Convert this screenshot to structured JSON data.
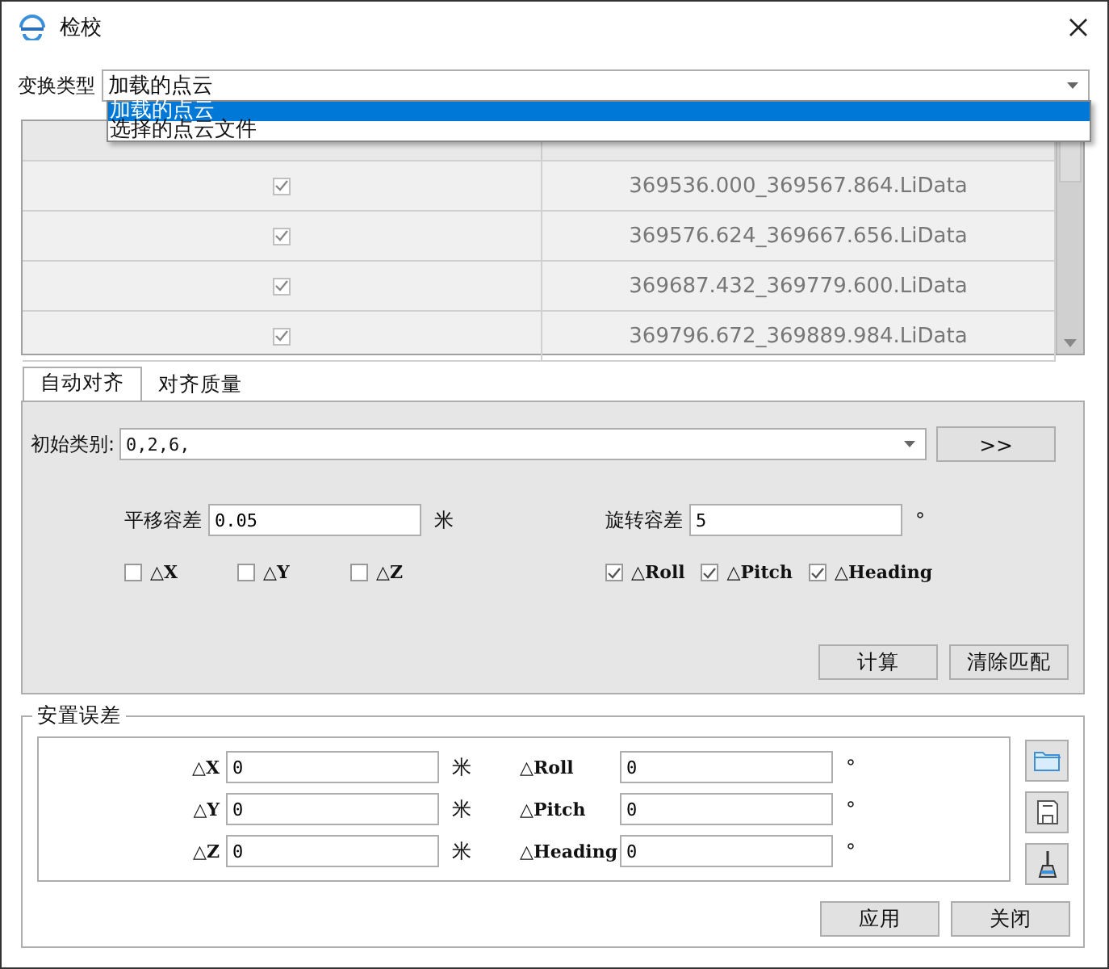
{
  "window": {
    "title": "检校"
  },
  "transform": {
    "label": "变换类型",
    "value": "加载的点云",
    "options": [
      {
        "label": "加载的点云",
        "selected": true
      },
      {
        "label": "选择的点云文件",
        "selected": false
      }
    ]
  },
  "table": {
    "rows": [
      {
        "checked": true,
        "file": "369536.000_369567.864.LiData"
      },
      {
        "checked": true,
        "file": "369576.624_369667.656.LiData"
      },
      {
        "checked": true,
        "file": "369687.432_369779.600.LiData"
      },
      {
        "checked": true,
        "file": "369796.672_369889.984.LiData"
      }
    ]
  },
  "tabs": [
    {
      "label": "自动对齐",
      "selected": true
    },
    {
      "label": "对齐质量",
      "selected": false
    }
  ],
  "auto_align": {
    "initial_class": {
      "label": "初始类别:",
      "value": "0,2,6,"
    },
    "more_button": ">>",
    "translation_tolerance": {
      "label": "平移容差",
      "value": "0.05",
      "unit": "米"
    },
    "rotation_tolerance": {
      "label": "旋转容差",
      "value": "5",
      "unit": "°"
    },
    "translation_axes": [
      {
        "label": "△X",
        "checked": false
      },
      {
        "label": "△Y",
        "checked": false
      },
      {
        "label": "△Z",
        "checked": false
      }
    ],
    "rotation_axes": [
      {
        "label": "△Roll",
        "checked": true
      },
      {
        "label": "△Pitch",
        "checked": true
      },
      {
        "label": "△Heading",
        "checked": true
      }
    ],
    "buttons": [
      "计算",
      "清除匹配"
    ]
  },
  "mounting_error": {
    "title": "安置误差",
    "fields": [
      {
        "label": "△X",
        "value": "0",
        "unit": "米"
      },
      {
        "label": "△Roll",
        "value": "0",
        "unit": "°"
      },
      {
        "label": "△Y",
        "value": "0",
        "unit": "米"
      },
      {
        "label": "△Pitch",
        "value": "0",
        "unit": "°"
      },
      {
        "label": "△Z",
        "value": "0",
        "unit": "米"
      },
      {
        "label": "△Heading",
        "value": "0",
        "unit": "°"
      }
    ]
  },
  "buttons": [
    "应用",
    "关闭"
  ]
}
